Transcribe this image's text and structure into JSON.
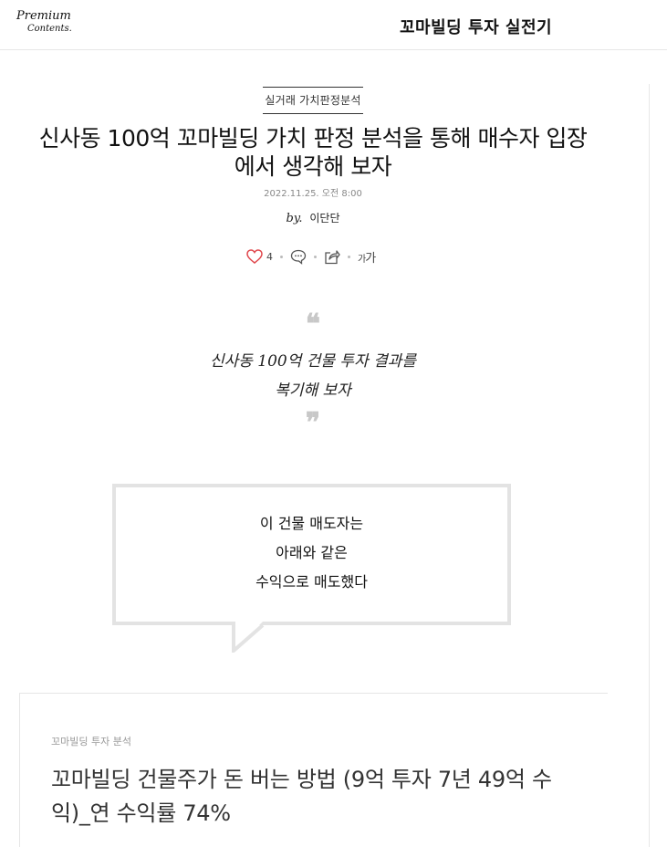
{
  "header": {
    "logo_line1": "Premium",
    "logo_line2": "Contents.",
    "series_title": "꼬마빌딩 투자 실전기"
  },
  "article": {
    "category": "실거래 가치판정분석",
    "title": "신사동 100억 꼬마빌딩 가치 판정 분석을 통해 매수자 입장에서 생각해 보자",
    "date": "2022.11.25. 오전 8:00",
    "by_label": "by.",
    "author": "이단단",
    "like_count": "4",
    "font_small": "가",
    "font_large": "가"
  },
  "quote": {
    "open_mark": "❝",
    "close_mark": "❞",
    "line1": "신사동 100억 건물 투자 결과를",
    "line2": "복기해 보자"
  },
  "speech": {
    "line1": "이 건물 매도자는",
    "line2": "아래와 같은",
    "line3": "수익으로 매도했다"
  },
  "card": {
    "category": "꼬마빌딩 투자 분석",
    "title": "꼬마빌딩 건물주가 돈 버는 방법 (9억 투자 7년 49억 수익)_연 수익률 74%"
  },
  "icons": [
    "heart-icon",
    "comment-icon",
    "share-icon",
    "font-size-icon"
  ],
  "colors": {
    "heart": "#e0474c",
    "border": "#e3e3e3",
    "muted": "#999999"
  }
}
